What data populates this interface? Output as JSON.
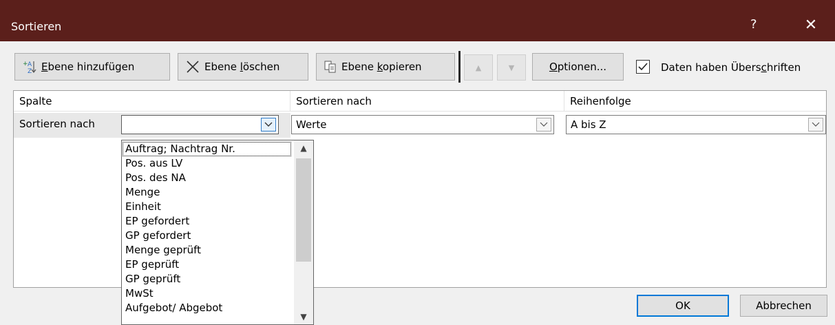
{
  "window": {
    "title": "Sortieren",
    "help": "?",
    "close": "✕"
  },
  "toolbar": {
    "add_level": {
      "prefix": "",
      "mn": "E",
      "rest": "bene hinzufügen"
    },
    "delete_level": {
      "prefix": "Ebene ",
      "mn": "l",
      "rest": "öschen"
    },
    "copy_level": {
      "prefix": "Ebene ",
      "mn": "k",
      "rest": "opieren"
    },
    "options": {
      "mn": "O",
      "rest": "ptionen..."
    },
    "move_up": "▲",
    "move_down": "▼",
    "headers_checkbox": {
      "checked": true,
      "mark": "✓",
      "pre": "Daten haben Übers",
      "mn": "c",
      "rest": "hriften"
    }
  },
  "grid": {
    "columns": [
      "Spalte",
      "Sortieren nach",
      "Reihenfolge"
    ],
    "row": {
      "label": "Sortieren nach",
      "column_value": "",
      "sort_on_value": "Werte",
      "order_value": "A bis Z"
    }
  },
  "dropdown": {
    "items": [
      "Auftrag; Nachtrag Nr.",
      "Pos. aus LV",
      "Pos. des NA",
      "Menge",
      "Einheit",
      "EP gefordert",
      "GP gefordert",
      "Menge geprüft",
      "EP geprüft",
      "GP geprüft",
      "MwSt",
      "Aufgebot/ Abgebot"
    ],
    "scroll_up": "▲",
    "scroll_down": "▼"
  },
  "buttons": {
    "ok": "OK",
    "cancel": "Abbrechen"
  },
  "colors": {
    "titlebar": "#5b1f1b",
    "default_button_border": "#0078d7"
  }
}
